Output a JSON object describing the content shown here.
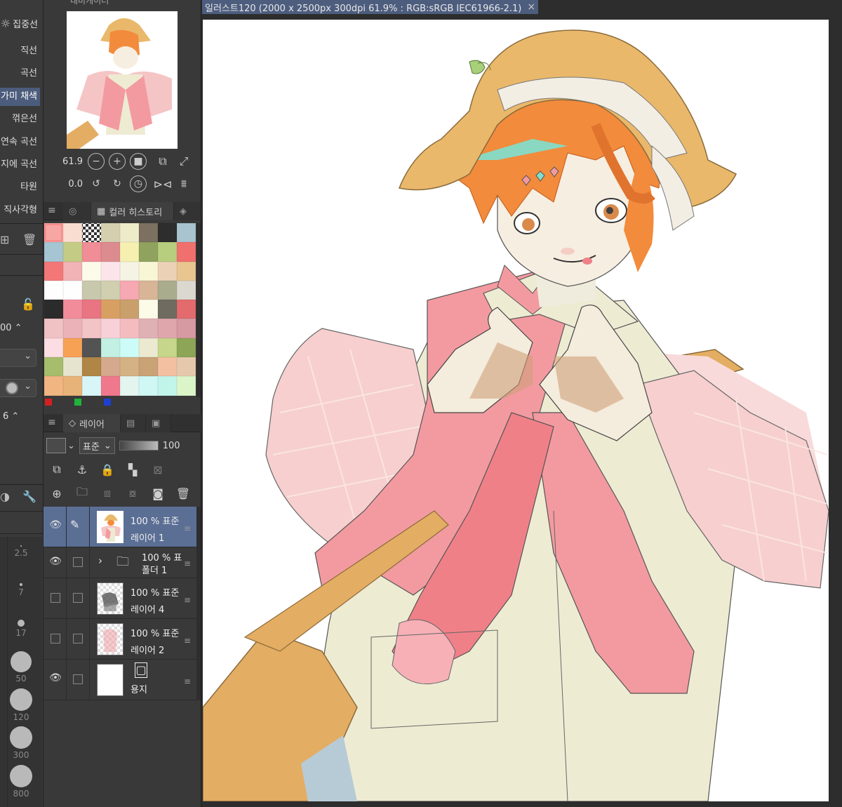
{
  "tool_panel": {
    "header_label": "집중선",
    "sub_tools": [
      "직선",
      "곡선",
      "가미 채색",
      "꺾은선",
      "연속 곡선",
      "지에 곡선",
      "타원",
      "직사각형"
    ],
    "active_sub_tool_index": 2,
    "opacity_value": "00",
    "size_value": "6"
  },
  "brush_sizes": [
    "2.5",
    "7",
    "17",
    "50",
    "120",
    "300",
    "800"
  ],
  "navigator": {
    "title_partial": "내비게이터",
    "zoom": "61.9",
    "rotation": "0.0"
  },
  "color_panel": {
    "tab_label": "컬러 히스토리",
    "swatches": [
      "#f7a7a3",
      "#f9ddd0",
      "checker",
      "#d5cfb0",
      "#eeebcb",
      "#7c7060",
      "#2e2d2d",
      "#a9c4cf",
      "#a5c5d2",
      "#c4cb85",
      "#f08d96",
      "#dc8b8f",
      "#f6f0b0",
      "#8fa35e",
      "#b7ce7e",
      "#f0706e",
      "#f47777",
      "#f2b3b6",
      "#fcfae8",
      "#fbe5ea",
      "#f5f4e4",
      "#f9f6d5",
      "#ebd2b7",
      "#e9c58f",
      "#fefefe",
      "#fefefe",
      "#c8c8ad",
      "#d0cfb0",
      "#f6a8b3",
      "#d8b596",
      "#a9ad8e",
      "#dbd9cf",
      "#2b2b2b",
      "#f28c9b",
      "#e97482",
      "#d7a062",
      "#c9a06b",
      "#fcfae8",
      "#6f6b60",
      "#e36a6d",
      "#f0c2c3",
      "#ebb3b8",
      "#f2c4c5",
      "#f8d0d8",
      "#f5bcc0",
      "#dfb1b5",
      "#dfa7ac",
      "#d59aa2",
      "#fbdde3",
      "#f7a155",
      "#535353",
      "#c2f0e3",
      "#cdfcf8",
      "#ebead0",
      "#c6d68a",
      "#8da557",
      "#a6bd6c",
      "#e6e4cf",
      "#b08646",
      "#d5a98d",
      "#d5b284",
      "#c9a276",
      "#f3c1a2",
      "#e6c9ad",
      "#f1b582",
      "#e8b379",
      "#d8f6f7",
      "#f0788d",
      "#e4f4ef",
      "#cff7f4",
      "#c2f5ea",
      "#dbf5c9"
    ]
  },
  "layer_panel": {
    "tab_label": "레이어",
    "blend_mode": "표준",
    "opacity": "100",
    "layers": [
      {
        "mode": "100 % 표준",
        "name": "레이어 1"
      },
      {
        "mode": "100 % 표",
        "name": "폴더 1"
      },
      {
        "mode": "100 % 표준",
        "name": "레이어 4"
      },
      {
        "mode": "100 % 표준",
        "name": "레이어 2"
      },
      {
        "mode": "",
        "name": "용지"
      }
    ]
  },
  "canvas": {
    "tab_title": "일러스트120 (2000 x 2500px 300dpi 61.9% : RGB:sRGB IEC61966-2.1)",
    "close_glyph": "×"
  },
  "colors": {
    "accent": "#4d5d7e",
    "panel": "#393939",
    "hat": "#e9b86b",
    "hair": "#f28b3c",
    "pink": "#f39aa0",
    "cream": "#eeebd3"
  }
}
